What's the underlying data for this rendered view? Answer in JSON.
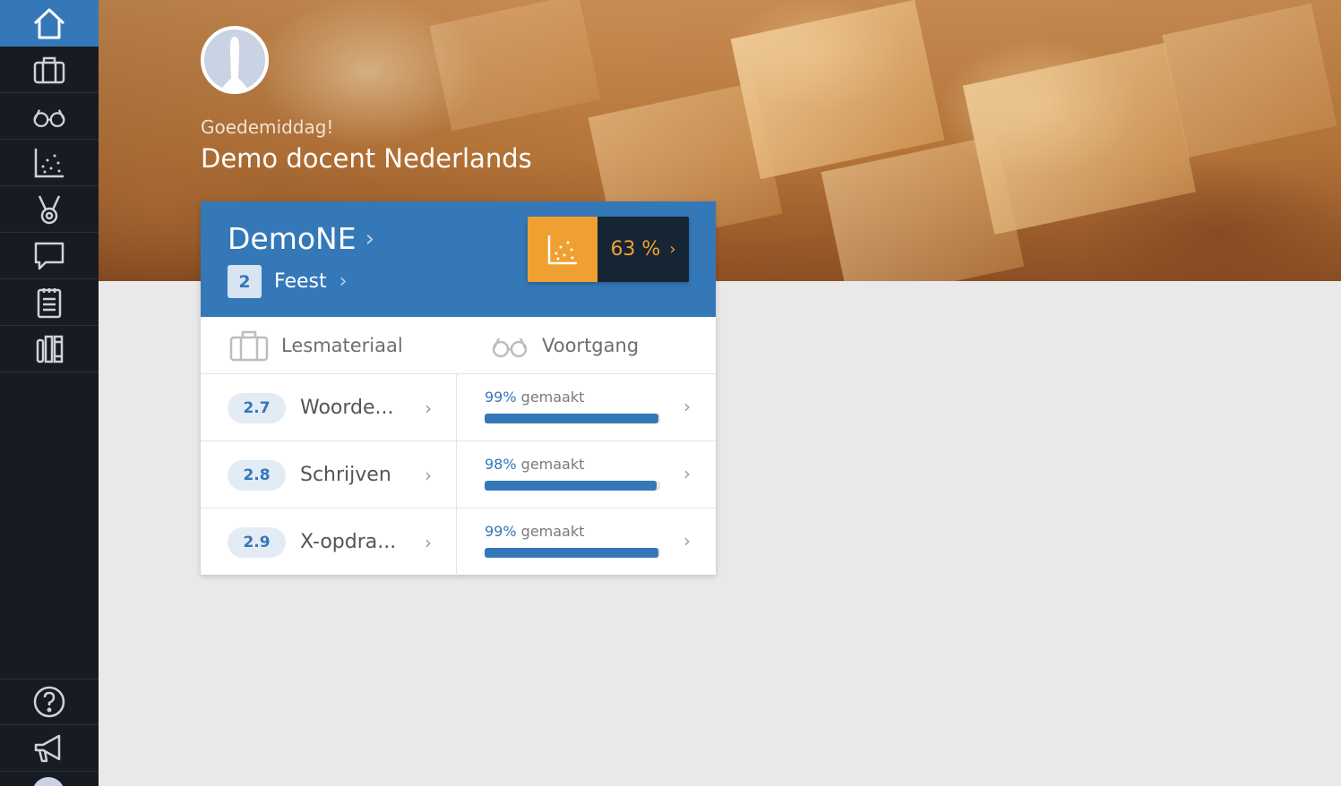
{
  "sidebar": {
    "items": [
      {
        "name": "home-icon",
        "active": true
      },
      {
        "name": "briefcase-icon",
        "active": false
      },
      {
        "name": "glasses-icon",
        "active": false
      },
      {
        "name": "scatter-chart-icon",
        "active": false
      },
      {
        "name": "medal-icon",
        "active": false
      },
      {
        "name": "chat-icon",
        "active": false
      },
      {
        "name": "clipboard-icon",
        "active": false
      },
      {
        "name": "books-icon",
        "active": false
      }
    ],
    "bottom_items": [
      {
        "name": "help-icon"
      },
      {
        "name": "megaphone-icon"
      }
    ]
  },
  "header": {
    "greeting": "Goedemiddag!",
    "teacher_name": "Demo docent Nederlands"
  },
  "course": {
    "title": "DemoNE",
    "chapter_number": "2",
    "chapter_title": "Feest",
    "score": "63 %",
    "tabs": {
      "material": "Lesmateriaal",
      "progress": "Voortgang"
    },
    "lessons": [
      {
        "number": "2.7",
        "title": "Woorde...",
        "percent_label": "99%",
        "suffix": "gemaakt",
        "progress": 0.99
      },
      {
        "number": "2.8",
        "title": "Schrijven",
        "percent_label": "98%",
        "suffix": "gemaakt",
        "progress": 0.98
      },
      {
        "number": "2.9",
        "title": "X-opdra...",
        "percent_label": "99%",
        "suffix": "gemaakt",
        "progress": 0.99
      }
    ]
  },
  "colors": {
    "accent_blue": "#3478b8",
    "score_orange": "#f0a030",
    "sidebar_bg": "#171b22"
  }
}
